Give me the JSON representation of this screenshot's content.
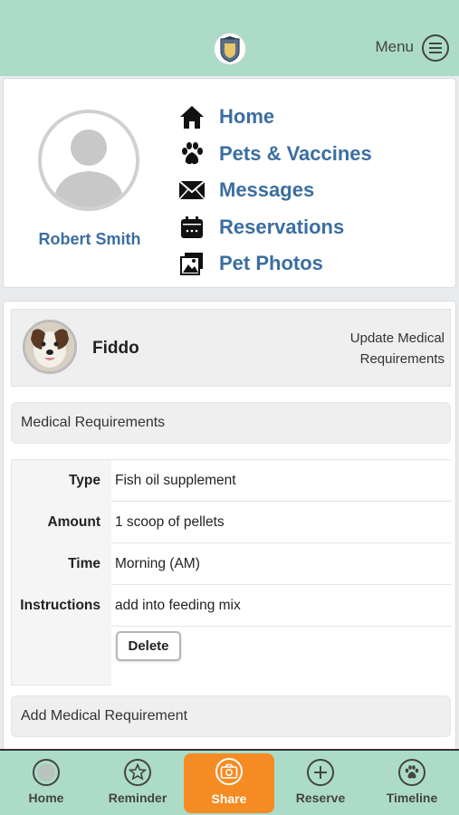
{
  "header": {
    "menu_label": "Menu"
  },
  "profile": {
    "name": "Robert Smith"
  },
  "nav": [
    {
      "label": "Home",
      "icon": "home-icon"
    },
    {
      "label": "Pets & Vaccines",
      "icon": "paw-icon"
    },
    {
      "label": "Messages",
      "icon": "envelope-icon"
    },
    {
      "label": "Reservations",
      "icon": "calendar-icon"
    },
    {
      "label": "Pet Photos",
      "icon": "photos-icon"
    }
  ],
  "pet": {
    "name": "Fiddo",
    "update_label": "Update Medical Requirements"
  },
  "medical": {
    "section_title": "Medical Requirements",
    "rows": [
      {
        "label": "Type",
        "value": "Fish oil supplement"
      },
      {
        "label": "Amount",
        "value": "1 scoop of pellets"
      },
      {
        "label": "Time",
        "value": "Morning (AM)"
      },
      {
        "label": "Instructions",
        "value": "add into feeding mix"
      }
    ],
    "delete_label": "Delete",
    "add_label": "Add Medical Requirement"
  },
  "tabs": [
    {
      "label": "Home",
      "icon": "circle-icon",
      "active": false
    },
    {
      "label": "Reminder",
      "icon": "star-icon",
      "active": false
    },
    {
      "label": "Share",
      "icon": "camera-icon",
      "active": true
    },
    {
      "label": "Reserve",
      "icon": "plus-icon",
      "active": false
    },
    {
      "label": "Timeline",
      "icon": "paw-icon",
      "active": false
    }
  ],
  "colors": {
    "header_bg": "#acdcc7",
    "link_blue": "#3b6ea0",
    "active_tab": "#f58b22"
  }
}
